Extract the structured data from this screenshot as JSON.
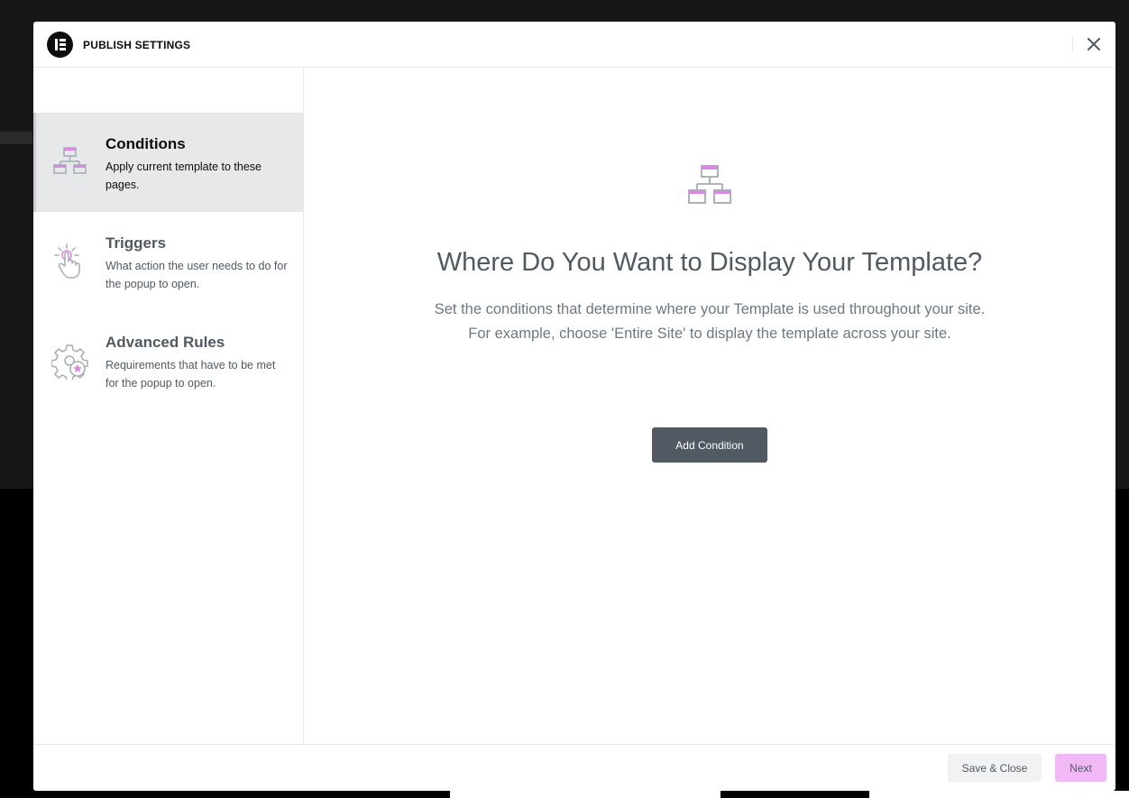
{
  "header": {
    "title": "PUBLISH SETTINGS",
    "logo_icon": "elementor-logo-icon",
    "close_icon": "close-icon"
  },
  "sidebar": {
    "tabs": [
      {
        "title": "Conditions",
        "description": "Apply current template to these pages.",
        "icon": "sitemap-icon",
        "active": true
      },
      {
        "title": "Triggers",
        "description": "What action the user needs to do for the popup to open.",
        "icon": "pointer-click-icon",
        "active": false
      },
      {
        "title": "Advanced Rules",
        "description": "Requirements that have to be met for the popup to open.",
        "icon": "gear-star-icon",
        "active": false
      }
    ]
  },
  "main": {
    "icon": "sitemap-icon",
    "title": "Where Do You Want to Display Your Template?",
    "description_line1": "Set the conditions that determine where your Template is used throughout your site.",
    "description_line2": "For example, choose 'Entire Site' to display the template across your site.",
    "add_button": "Add Condition"
  },
  "footer": {
    "save_close": "Save & Close",
    "next": "Next"
  },
  "colors": {
    "accent_pink": "#f0b9f5",
    "icon_pink": "#d88ae3",
    "text_dark": "#0c0d0e",
    "text_gray": "#515962",
    "button_dark": "#515962"
  }
}
